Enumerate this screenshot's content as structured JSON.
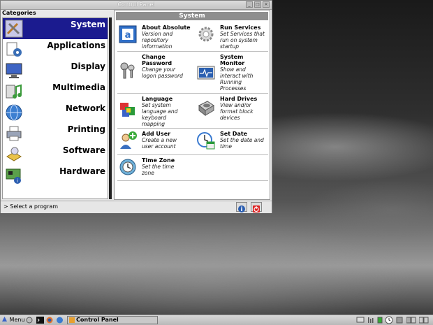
{
  "window": {
    "title": "Control Panel"
  },
  "categories": {
    "header": "Categories",
    "items": [
      {
        "label": "System",
        "icon": "system-tools-icon",
        "selected": true
      },
      {
        "label": "Applications",
        "icon": "applications-icon",
        "selected": false
      },
      {
        "label": "Display",
        "icon": "display-icon",
        "selected": false
      },
      {
        "label": "Multimedia",
        "icon": "multimedia-icon",
        "selected": false
      },
      {
        "label": "Network",
        "icon": "network-globe-icon",
        "selected": false
      },
      {
        "label": "Printing",
        "icon": "printer-icon",
        "selected": false
      },
      {
        "label": "Software",
        "icon": "software-icon",
        "selected": false
      },
      {
        "label": "Hardware",
        "icon": "hardware-icon",
        "selected": false
      }
    ]
  },
  "panel": {
    "title": "System",
    "items": [
      {
        "name": "About Absolute",
        "desc": [
          "Version and",
          "repository",
          "information"
        ],
        "icon": "about-absolute-icon"
      },
      {
        "name": "Run Services",
        "desc": [
          "Set Services that",
          "run on system",
          "startup"
        ],
        "icon": "services-gear-icon"
      },
      {
        "name": "Change\nPassword",
        "desc": [
          "Change your",
          "logon password"
        ],
        "icon": "keys-icon"
      },
      {
        "name": "System\nMonitor",
        "desc": [
          "Show and",
          "interact with",
          "Running",
          "Processes"
        ],
        "icon": "system-monitor-icon"
      },
      {
        "name": "Language",
        "desc": [
          "Set system",
          "language and",
          "keyboard",
          "mapping"
        ],
        "icon": "language-flag-icon"
      },
      {
        "name": "Hard Drives",
        "desc": [
          "View and/or",
          "format block",
          "devices"
        ],
        "icon": "hard-drive-icon"
      },
      {
        "name": "Add User",
        "desc": [
          "Create a new",
          "user account"
        ],
        "icon": "add-user-icon"
      },
      {
        "name": "Set Date",
        "desc": [
          "Set the date and",
          "time"
        ],
        "icon": "clock-calendar-icon"
      },
      {
        "name": "Time Zone",
        "desc": [
          "Set the time",
          "zone"
        ],
        "icon": "time-zone-icon"
      }
    ]
  },
  "status": {
    "text": "> Select a program"
  },
  "taskbar": {
    "menu_label": "Menu",
    "task_label": "Control Panel"
  },
  "colors": {
    "selection": "#1b1b8f",
    "panel_header": "#8e8e8e"
  }
}
